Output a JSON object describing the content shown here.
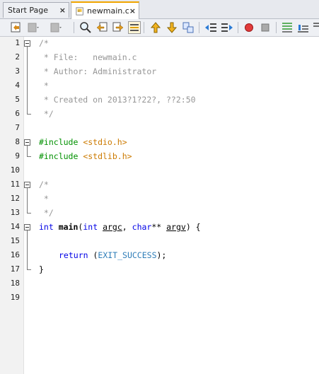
{
  "tabs": [
    {
      "label": "Start Page",
      "close": "×",
      "active": false
    },
    {
      "label": "newmain.c",
      "close": "×",
      "active": true
    }
  ],
  "toolbar": {
    "icons": [
      "last-edit-icon",
      "back-icon",
      "forward-icon",
      "find-icon",
      "find-previous-icon",
      "find-next-icon",
      "toggle-highlight-icon",
      "previous-bookmark-icon",
      "next-bookmark-icon",
      "toggle-bookmark-icon",
      "shift-left-icon",
      "shift-right-icon",
      "start-macro-icon",
      "stop-macro-icon",
      "line-icon",
      "comment-icon",
      "uncomment-icon"
    ]
  },
  "editor": {
    "line_numbers": [
      "1",
      "2",
      "3",
      "4",
      "5",
      "6",
      "7",
      "8",
      "9",
      "10",
      "11",
      "12",
      "13",
      "14",
      "15",
      "16",
      "17",
      "18",
      "19"
    ],
    "lines": {
      "l1": "/*",
      "l2": " * File:   newmain.c",
      "l3": " * Author: Administrator",
      "l4": " *",
      "l5": " * Created on 2013?1?22?, ??2:50",
      "l6": " */",
      "l8_pre": "#include ",
      "l8_inc": "<stdio.h>",
      "l9_pre": "#include ",
      "l9_inc": "<stdlib.h>",
      "l11": "/*",
      "l12": " *",
      "l13": " */",
      "l14_int": "int",
      "l14_main": "main",
      "l14_open": "(",
      "l14_int2": "int",
      "l14_argc": "argc",
      "l14_comma": ", ",
      "l14_char": "char",
      "l14_stars": "** ",
      "l14_argv": "argv",
      "l14_close": ") {",
      "l16_return": "return",
      "l16_open": " (",
      "l16_macro": "EXIT_SUCCESS",
      "l16_close": ");",
      "l17": "}"
    }
  },
  "colors": {
    "comment": "#969696",
    "preprocessor": "#009100",
    "include": "#cc7a00",
    "keyword": "#0000e6",
    "macro": "#2e7db8"
  }
}
